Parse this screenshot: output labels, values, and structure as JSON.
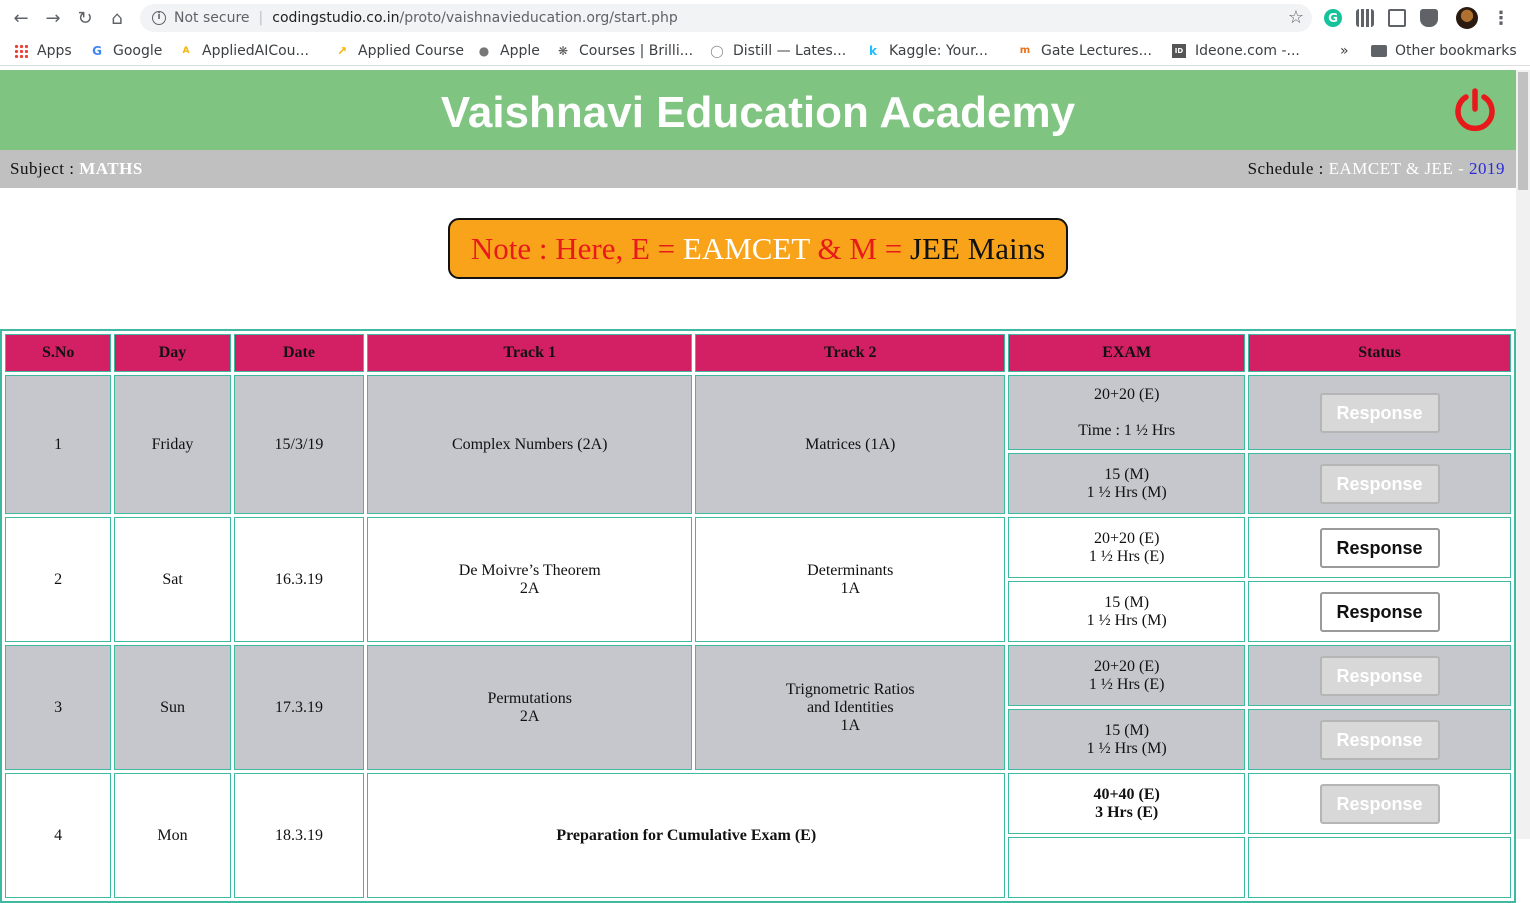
{
  "browser": {
    "security_label": "Not secure",
    "url_host": "codingstudio.co.in",
    "url_path": "/proto/vaishnavieducation.org/start.php",
    "bookmarks": [
      "Apps",
      "Google",
      "AppliedAICou...",
      "Applied Course",
      "Apple",
      "Courses | Brilli...",
      "Distill — Lates...",
      "Kaggle: Your...",
      "Gate Lectures...",
      "Ideone.com -..."
    ],
    "overflow_label": "»",
    "other_bookmarks": "Other bookmarks"
  },
  "header": {
    "title": "Vaishnavi Education Academy",
    "subject_label": "Subject : ",
    "subject_value": "MATHS",
    "schedule_label": "Schedule : ",
    "schedule_value": "EAMCET & JEE - ",
    "schedule_year": "2019"
  },
  "note": {
    "prefix": "Note : Here, E = ",
    "e_value": "EAMCET",
    "mid": " & M = ",
    "m_value": "JEE Mains"
  },
  "table": {
    "headers": [
      "S.No",
      "Day",
      "Date",
      "Track 1",
      "Track 2",
      "EXAM",
      "Status"
    ],
    "button_label": "Response",
    "rows": [
      {
        "sno": "1",
        "day": "Friday",
        "date": "15/3/19",
        "track1": [
          "Complex Numbers (2A)"
        ],
        "track2": [
          "Matrices (1A)"
        ],
        "exam_e": [
          "20+20 (E)",
          "",
          "Time : 1 ½ Hrs"
        ],
        "exam_m": [
          "15 (M)",
          "1 ½ Hrs (M)"
        ]
      },
      {
        "sno": "2",
        "day": "Sat",
        "date": "16.3.19",
        "track1": [
          "De Moivre’s Theorem",
          "2A"
        ],
        "track2": [
          "Determinants",
          "1A"
        ],
        "exam_e": [
          "20+20 (E)",
          "1 ½ Hrs (E)"
        ],
        "exam_m": [
          "15 (M)",
          "1 ½ Hrs (M)"
        ]
      },
      {
        "sno": "3",
        "day": "Sun",
        "date": "17.3.19",
        "track1": [
          "Permutations",
          "2A"
        ],
        "track2": [
          "Trignometric Ratios",
          "and Identities",
          "1A"
        ],
        "exam_e": [
          "20+20 (E)",
          "1 ½ Hrs (E)"
        ],
        "exam_m": [
          "15 (M)",
          "1 ½ Hrs (M)"
        ]
      },
      {
        "sno": "4",
        "day": "Mon",
        "date": "18.3.19",
        "merged_track": [
          "Preparation for Cumulative Exam (E)"
        ],
        "exam_e": [
          "40+40 (E)",
          "3 Hrs (E)"
        ]
      }
    ]
  },
  "colors": {
    "header_green": "#80c481",
    "table_header": "#d31f63",
    "note_bg": "#f9a31b",
    "power_red": "#e8191b"
  }
}
